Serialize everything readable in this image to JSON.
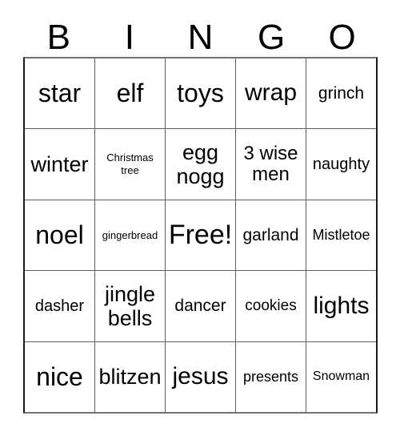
{
  "card": {
    "title": "BINGO",
    "header_letters": [
      "B",
      "I",
      "N",
      "G",
      "O"
    ],
    "free_space_label": "Free!",
    "colors": {
      "text": "#000000",
      "grid_line": "#5e5e5e",
      "border": "#1a1a1a",
      "background": "#ffffff"
    },
    "rows": [
      {
        "cells": [
          {
            "text": "star",
            "size": "fs-h2"
          },
          {
            "text": "elf",
            "size": "fs-h2"
          },
          {
            "text": "toys",
            "size": "fs-h2"
          },
          {
            "text": "wrap",
            "size": "fs-h1"
          },
          {
            "text": "grinch",
            "size": "fs-lg"
          }
        ]
      },
      {
        "cells": [
          {
            "text": "winter",
            "size": "fs-xxl"
          },
          {
            "text": "Christmas tree",
            "size": "fs-xs"
          },
          {
            "text": "egg nogg",
            "size": "fs-xxl"
          },
          {
            "text": "3 wise men",
            "size": "fs-xl"
          },
          {
            "text": "naughty",
            "size": "fs-mdp"
          }
        ]
      },
      {
        "cells": [
          {
            "text": "noel",
            "size": "fs-h2"
          },
          {
            "text": "gingerbread",
            "size": "fs-xs"
          },
          {
            "text": "Free!",
            "size": "fs-free"
          },
          {
            "text": "garland",
            "size": "fs-lg"
          },
          {
            "text": "Mistletoe",
            "size": "fs-smp"
          }
        ]
      },
      {
        "cells": [
          {
            "text": "dasher",
            "size": "fs-mdp"
          },
          {
            "text": "jingle bells",
            "size": "fs-xxl"
          },
          {
            "text": "dancer",
            "size": "fs-lg"
          },
          {
            "text": "cookies",
            "size": "fs-md"
          },
          {
            "text": "lights",
            "size": "fs-h1"
          }
        ]
      },
      {
        "cells": [
          {
            "text": "nice",
            "size": "fs-h2"
          },
          {
            "text": "blitzen",
            "size": "fs-xxl"
          },
          {
            "text": "jesus",
            "size": "fs-h1"
          },
          {
            "text": "presents",
            "size": "fs-smp"
          },
          {
            "text": "Snowman",
            "size": "fs-sm"
          }
        ]
      }
    ]
  }
}
